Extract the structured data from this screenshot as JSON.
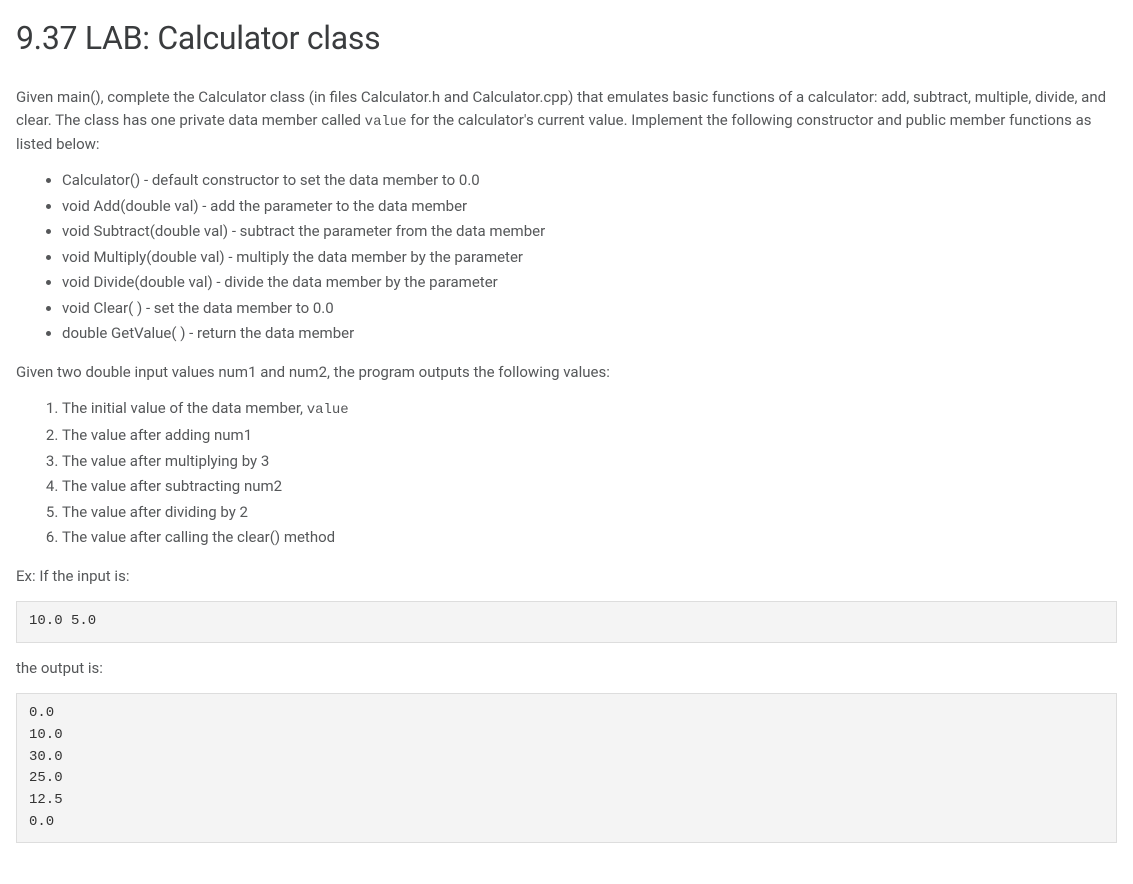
{
  "title": "9.37 LAB: Calculator class",
  "intro": {
    "part1": "Given main(), complete the Calculator class (in files Calculator.h and Calculator.cpp) that emulates basic functions of a calculator: add, subtract, multiple, divide, and clear. The class has one private data member called ",
    "code1": "value",
    "part2": " for the calculator's current value. Implement the following constructor and public member functions as listed below:"
  },
  "funcs": [
    "Calculator() - default constructor to set the data member to 0.0",
    "void Add(double val) - add the parameter to the data member",
    "void Subtract(double val) - subtract the parameter from the data member",
    "void Multiply(double val) - multiply the data member by the parameter",
    "void Divide(double val) - divide the data member by the parameter",
    "void Clear( ) - set the data member to 0.0",
    "double GetValue( ) - return the data member"
  ],
  "outputsLead": "Given two double input values num1 and num2, the program outputs the following values:",
  "steps": {
    "s1a": "The initial value of the data member, ",
    "s1code": "value",
    "s2": "The value after adding num1",
    "s3": "The value after multiplying by 3",
    "s4": "The value after subtracting num2",
    "s5": "The value after dividing by 2",
    "s6": "The value after calling the clear() method"
  },
  "exLabel": "Ex: If the input is:",
  "exInput": "10.0 5.0",
  "outLabel": "the output is:",
  "exOutput": "0.0\n10.0\n30.0\n25.0\n12.5\n0.0"
}
